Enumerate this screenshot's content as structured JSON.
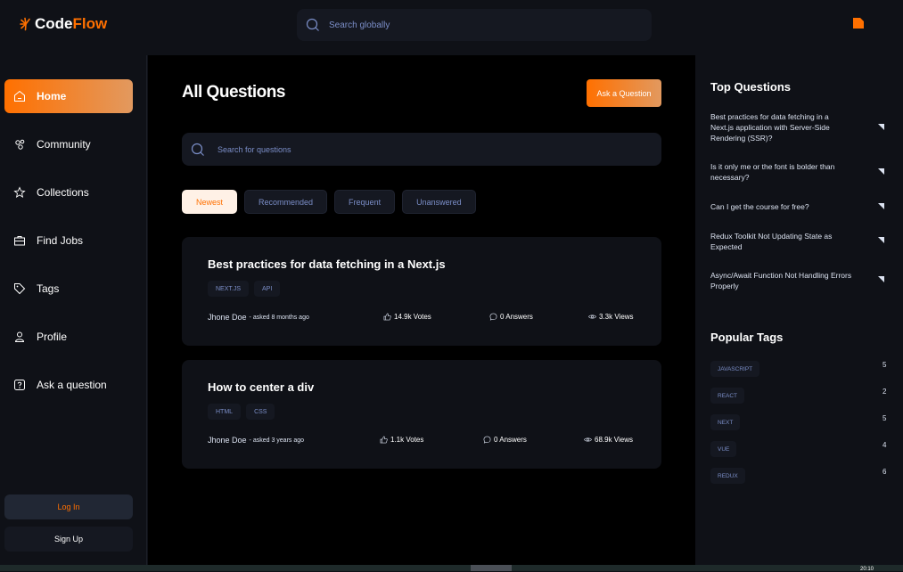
{
  "brand": {
    "code": "Code",
    "flow": "Flow"
  },
  "global_search": {
    "placeholder": "Search globally"
  },
  "sidebar": {
    "items": [
      {
        "label": "Home",
        "icon": "home-icon",
        "active": true
      },
      {
        "label": "Community",
        "icon": "users-icon"
      },
      {
        "label": "Collections",
        "icon": "star-icon"
      },
      {
        "label": "Find Jobs",
        "icon": "briefcase-icon"
      },
      {
        "label": "Tags",
        "icon": "tag-icon"
      },
      {
        "label": "Profile",
        "icon": "user-icon"
      },
      {
        "label": "Ask a question",
        "icon": "question-icon"
      }
    ],
    "login": "Log In",
    "signup": "Sign Up"
  },
  "main": {
    "title": "All Questions",
    "ask_button": "Ask a Question",
    "search_placeholder": "Search for questions",
    "filters": [
      "Newest",
      "Recommended",
      "Frequent",
      "Unanswered"
    ],
    "questions": [
      {
        "title": "Best practices for data fetching in a Next.js",
        "tags": [
          "NEXT.JS",
          "API"
        ],
        "author": "Jhone Doe",
        "asked": "- asked 8 months ago",
        "votes": "14.9k Votes",
        "answers": "0 Answers",
        "views": "3.3k Views"
      },
      {
        "title": "How to center a div",
        "tags": [
          "HTML",
          "CSS"
        ],
        "author": "Jhone Doe",
        "asked": "- asked 3 years ago",
        "votes": "1.1k Votes",
        "answers": "0 Answers",
        "views": "68.9k Views"
      }
    ]
  },
  "right": {
    "top_title": "Top Questions",
    "top_questions": [
      "Best practices for data fetching in a Next.js application with Server-Side Rendering (SSR)?",
      "Is it only me or the font is bolder than necessary?",
      "Can I get the course for free?",
      "Redux Toolkit Not Updating State as Expected",
      "Async/Await Function Not Handling Errors Properly"
    ],
    "tags_title": "Popular Tags",
    "popular_tags": [
      {
        "name": "JAVASCRIPT",
        "count": "5"
      },
      {
        "name": "REACT",
        "count": "2"
      },
      {
        "name": "NEXT",
        "count": "5"
      },
      {
        "name": "VUE",
        "count": "4"
      },
      {
        "name": "REDUX",
        "count": "6"
      }
    ]
  },
  "taskbar": {
    "clock": "20:10"
  },
  "colors": {
    "accent": "#ff7000",
    "accent_light": "#e2995f",
    "bg": "#0f1117",
    "main_bg": "#000000",
    "muted": "#7b8ec8"
  }
}
